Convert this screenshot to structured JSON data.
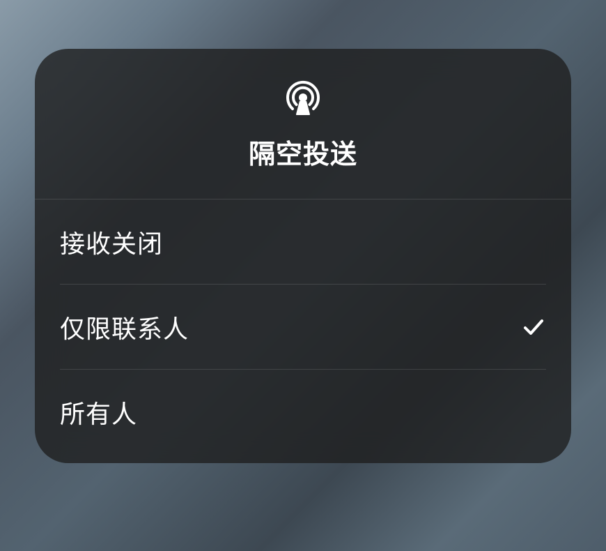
{
  "panel": {
    "title": "隔空投送",
    "icon": "airdrop-icon",
    "options": [
      {
        "label": "接收关闭",
        "selected": false
      },
      {
        "label": "仅限联系人",
        "selected": true
      },
      {
        "label": "所有人",
        "selected": false
      }
    ]
  }
}
